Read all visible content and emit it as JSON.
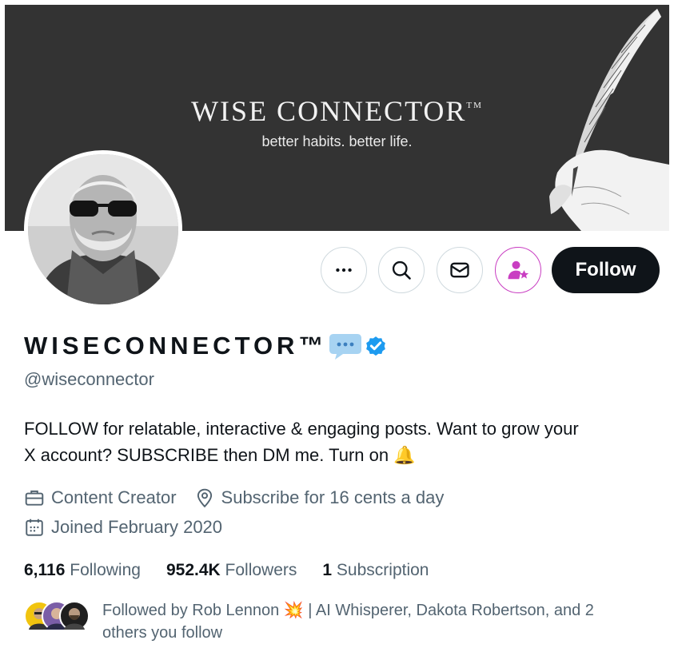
{
  "banner": {
    "title": "WISE CONNECTOR",
    "trademark": "TM",
    "subtitle": "better habits. better life.",
    "background": "#333333"
  },
  "actions": {
    "more_icon": "more-icon",
    "search_icon": "search-icon",
    "message_icon": "mail-icon",
    "subscribe_icon": "subscribe-icon",
    "follow_label": "Follow"
  },
  "profile": {
    "display_name": "WISECONNECTOR™",
    "handle": "@wiseconnector",
    "bio_line1": "FOLLOW for relatable, interactive & engaging posts. Want to grow your",
    "bio_line2": "X account? SUBSCRIBE then DM me. Turn on",
    "bio_emoji": "🔔",
    "category": "Content Creator",
    "location": "Subscribe for 16 cents a day",
    "joined": "Joined February 2020"
  },
  "stats": {
    "following_count": "6,116",
    "following_label": "Following",
    "followers_count": "952.4K",
    "followers_label": "Followers",
    "subscription_count": "1",
    "subscription_label": "Subscription"
  },
  "followed_by": {
    "text_line1": "Followed by Rob Lennon 💥 | AI Whisperer, Dakota Robertson, and 2",
    "text_line2": "others you follow"
  },
  "colors": {
    "accent": "#1d9bf0",
    "subscribe": "#c93ec2",
    "primary_text": "#0f1419",
    "secondary_text": "#536471"
  }
}
